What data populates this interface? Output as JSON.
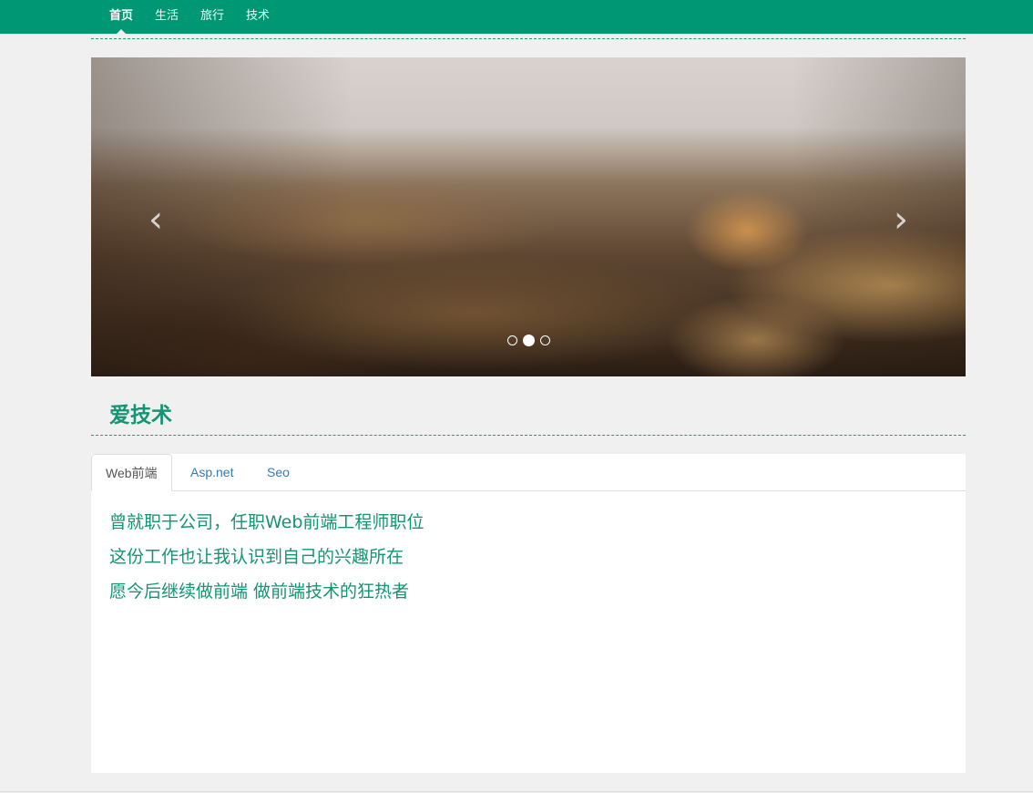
{
  "nav": {
    "items": [
      {
        "label": "首页",
        "active": true
      },
      {
        "label": "生活",
        "active": false
      },
      {
        "label": "旅行",
        "active": false
      },
      {
        "label": "技术",
        "active": false
      }
    ]
  },
  "carousel": {
    "image": "padlocks-photo",
    "prev_icon": "chevron-left-icon",
    "next_icon": "chevron-right-icon",
    "prev_glyph": "‹",
    "next_glyph": "›",
    "active_index": 2,
    "slide_count": 3
  },
  "section": {
    "title": "爱技术"
  },
  "tabs": [
    {
      "label": "Web前端",
      "active": true
    },
    {
      "label": "Asp.net",
      "active": false
    },
    {
      "label": "Seo",
      "active": false
    }
  ],
  "content": {
    "lines": [
      "曾就职于公司，任职Web前端工程师职位",
      "这份工作也让我认识到自己的兴趣所在",
      "愿今后继续做前端 做前端技术的狂热者"
    ]
  },
  "colors": {
    "brand": "#009874",
    "accent_text": "#149473",
    "link": "#337ab7"
  }
}
